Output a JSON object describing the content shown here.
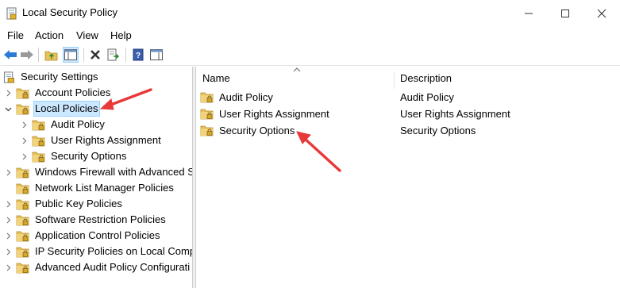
{
  "window": {
    "title": "Local Security Policy"
  },
  "menu": {
    "items": [
      "File",
      "Action",
      "View",
      "Help"
    ]
  },
  "tree": {
    "root": "Security Settings",
    "items": [
      {
        "label": "Account Policies",
        "indent": 1,
        "expander": "collapsed"
      },
      {
        "label": "Local Policies",
        "indent": 1,
        "expander": "expanded",
        "selected": true
      },
      {
        "label": "Audit Policy",
        "indent": 2,
        "expander": "collapsed"
      },
      {
        "label": "User Rights Assignment",
        "indent": 2,
        "expander": "collapsed"
      },
      {
        "label": "Security Options",
        "indent": 2,
        "expander": "collapsed"
      },
      {
        "label": "Windows Firewall with Advanced S",
        "indent": 1,
        "expander": "collapsed"
      },
      {
        "label": "Network List Manager Policies",
        "indent": 1,
        "expander": "none"
      },
      {
        "label": "Public Key Policies",
        "indent": 1,
        "expander": "collapsed"
      },
      {
        "label": "Software Restriction Policies",
        "indent": 1,
        "expander": "collapsed"
      },
      {
        "label": "Application Control Policies",
        "indent": 1,
        "expander": "collapsed"
      },
      {
        "label": "IP Security Policies on Local Comp",
        "indent": 1,
        "expander": "collapsed"
      },
      {
        "label": "Advanced Audit Policy Configurati",
        "indent": 1,
        "expander": "collapsed"
      }
    ]
  },
  "list": {
    "columns": {
      "name": "Name",
      "description": "Description"
    },
    "rows": [
      {
        "name": "Audit Policy",
        "description": "Audit Policy"
      },
      {
        "name": "User Rights Assignment",
        "description": "User Rights Assignment"
      },
      {
        "name": "Security Options",
        "description": "Security Options"
      }
    ]
  },
  "colors": {
    "selection_bg": "#cce8ff",
    "selection_border": "#99d1ff",
    "folder": "#e8c15a",
    "arrow": "#e8393a"
  },
  "icons": {
    "app": "security-policy-icon",
    "folder": "locked-folder-icon"
  }
}
